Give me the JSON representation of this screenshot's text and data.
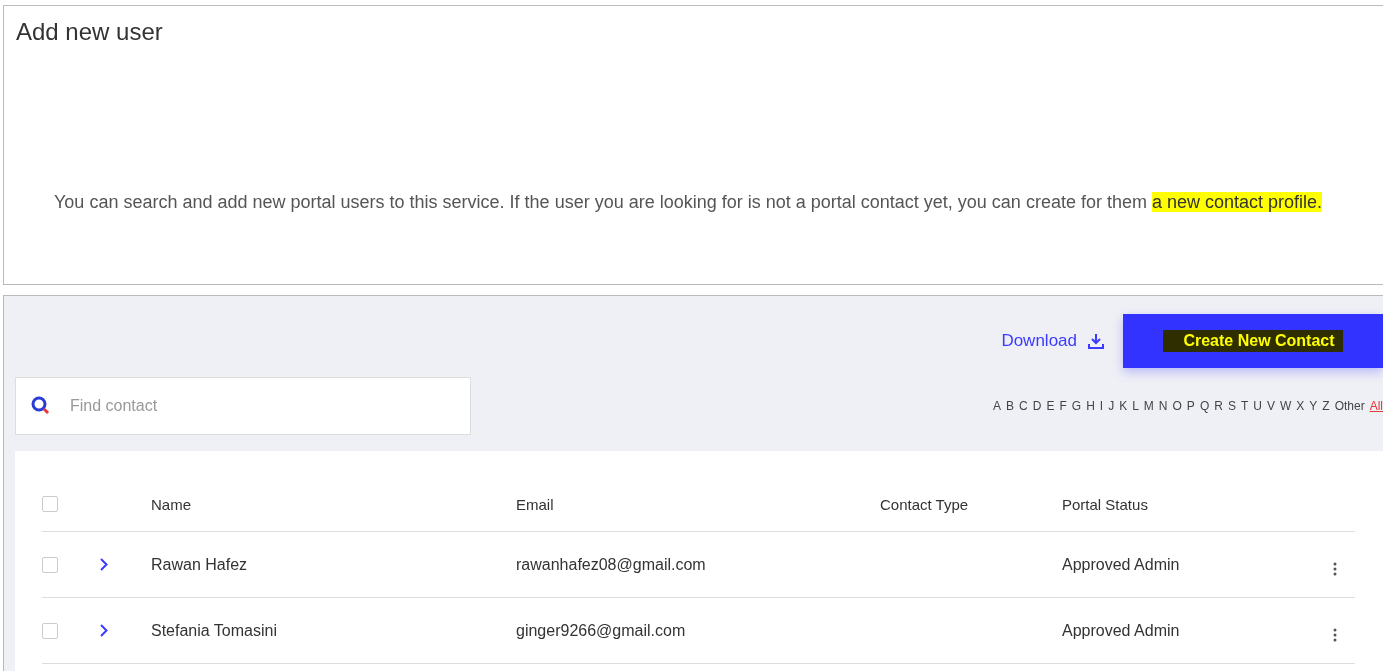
{
  "header": {
    "title": "Add new user",
    "description": "You can search and add new portal users to this service. If the user you are looking for is not a portal contact yet, you can create for them",
    "description_link": "a new contact profile."
  },
  "toolbar": {
    "download": "Download",
    "create_button": "Create New Contact"
  },
  "search": {
    "placeholder": "Find contact"
  },
  "alphabet": [
    {
      "label": "A",
      "selected": false
    },
    {
      "label": "B",
      "selected": false
    },
    {
      "label": "C",
      "selected": false
    },
    {
      "label": "D",
      "selected": false
    },
    {
      "label": "E",
      "selected": false
    },
    {
      "label": "F",
      "selected": false
    },
    {
      "label": "G",
      "selected": false
    },
    {
      "label": "H",
      "selected": false
    },
    {
      "label": "I",
      "selected": false
    },
    {
      "label": "J",
      "selected": false
    },
    {
      "label": "K",
      "selected": false
    },
    {
      "label": "L",
      "selected": false
    },
    {
      "label": "M",
      "selected": false
    },
    {
      "label": "N",
      "selected": false
    },
    {
      "label": "O",
      "selected": false
    },
    {
      "label": "P",
      "selected": false
    },
    {
      "label": "Q",
      "selected": false
    },
    {
      "label": "R",
      "selected": false
    },
    {
      "label": "S",
      "selected": false
    },
    {
      "label": "T",
      "selected": false
    },
    {
      "label": "U",
      "selected": false
    },
    {
      "label": "V",
      "selected": false
    },
    {
      "label": "W",
      "selected": false
    },
    {
      "label": "X",
      "selected": false
    },
    {
      "label": "Y",
      "selected": false
    },
    {
      "label": "Z",
      "selected": false
    },
    {
      "label": "Other",
      "selected": false
    },
    {
      "label": "All",
      "selected": true
    }
  ],
  "table": {
    "select_all_checked": false,
    "columns": [
      "Name",
      "Email",
      "Contact Type",
      "Portal Status"
    ],
    "rows": [
      {
        "checked": false,
        "name": "Rawan Hafez",
        "email": "rawanhafez08@gmail.com",
        "status": "Approved Admin"
      },
      {
        "checked": false,
        "name": "Stefania Tomasini",
        "email": "ginger9266@gmail.com",
        "status": "Approved Admin"
      }
    ]
  }
}
